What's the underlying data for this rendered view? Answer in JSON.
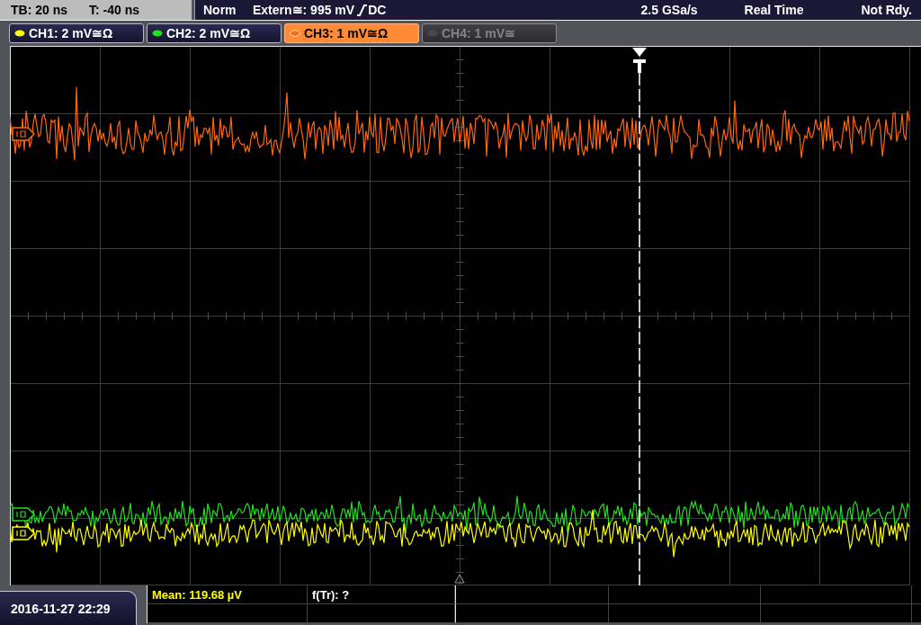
{
  "timebase_panel": {
    "timebase": "TB: 20 ns",
    "trigger_offset": "T: -40 ns"
  },
  "acquisition_bar": {
    "trigger_mode": "Norm",
    "trigger_level": "Extern≅: 995 mV",
    "slope_rising": true,
    "trigger_coupling": "DC",
    "sample_rate": "2.5 GSa/s",
    "acquisition_mode": "Real Time",
    "status": "Not Rdy."
  },
  "channels": [
    {
      "label": "CH1: 2 mV≅Ω",
      "color": "#ffff00",
      "selected": false,
      "enabled": true
    },
    {
      "label": "CH2: 2 mV≅Ω",
      "color": "#22e022",
      "selected": false,
      "enabled": true
    },
    {
      "label": "CH3: 1 mV≅Ω",
      "color": "#ff6610",
      "selected": true,
      "enabled": true
    },
    {
      "label": "CH4: 1 mV≅",
      "color": "#4a4a4a",
      "selected": false,
      "enabled": false
    }
  ],
  "measurements": {
    "cells": [
      {
        "text": "Mean: 119.68 µV",
        "color": "#ffff00"
      },
      {
        "text": "f(Tr): ?",
        "color": "#ffffff"
      }
    ]
  },
  "date_time": "2016-11-27 22:29"
}
